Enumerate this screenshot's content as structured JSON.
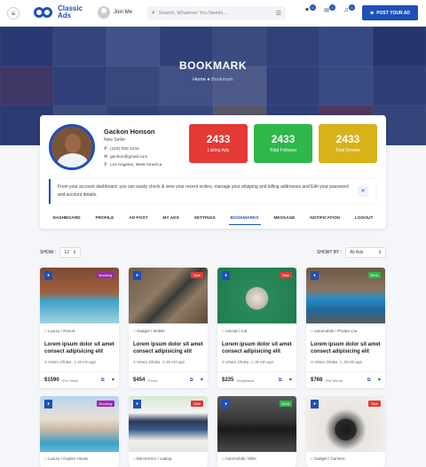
{
  "header": {
    "logo_line1": "Classic",
    "logo_line2": "Ads",
    "join": "Join Me",
    "search_placeholder": "Search, Whatever You Needs...",
    "post_label": "POST YOUR AD",
    "badges": [
      "0",
      "0",
      "0"
    ]
  },
  "hero": {
    "title": "BOOKMARK",
    "home": "Home",
    "current": "Bookmark"
  },
  "profile": {
    "name": "Gackon Honson",
    "role": "New Seller",
    "phone": "(123) 000-1234",
    "email": "gackon@gmail.com",
    "location": "Los Angeles, West America"
  },
  "stats": [
    {
      "value": "2433",
      "label": "Listing Ads",
      "color": "#e53935"
    },
    {
      "value": "2433",
      "label": "Total Follower",
      "color": "#2eb84a"
    },
    {
      "value": "2433",
      "label": "Total Review",
      "color": "#d9b21a"
    }
  ],
  "notice": "From your account dashboard. you can easily check & view your recent orders, manage your shipping and billing addresses and Edit your password and account details.",
  "tabs": [
    "DASHBOARD",
    "PROFILE",
    "AD POST",
    "MY ADS",
    "SETTINGS",
    "BOOKMARKS",
    "MESSAGE",
    "NOTIFICATION",
    "LOGOUT"
  ],
  "controls": {
    "show_label": "SHOW :",
    "show_value": "12",
    "sort_label": "SHORT BY :",
    "sort_value": "All Ads"
  },
  "ads": [
    {
      "cat": "Luxury / Resort",
      "title": "Lorem ipsum dolor sit amet consect adipisicing elit",
      "loc": "Uttara, Dhaka",
      "time": "30 min ago",
      "price": "$1590",
      "unit": "/Per Week",
      "badge": "Booking",
      "badge_color": "#9c27b0"
    },
    {
      "cat": "Gadget / Mobile",
      "title": "Lorem ipsum dolor sit amet consect adipisicing elit",
      "loc": "Uttara, Dhaka",
      "time": "30 min ago",
      "price": "$454",
      "unit": "/Fixed",
      "badge": "Sale",
      "badge_color": "#e53935"
    },
    {
      "cat": "Animal / Cat",
      "title": "Lorem ipsum dolor sit amet consect adipisicing elit",
      "loc": "Uttara, Dhaka",
      "time": "30 min ago",
      "price": "$235",
      "unit": "/Negotiable",
      "badge": "Sale",
      "badge_color": "#e53935"
    },
    {
      "cat": "Automobile / Private Car",
      "title": "Lorem ipsum dolor sit amet consect adipisicing elit",
      "loc": "Uttara, Dhaka",
      "time": "30 min ago",
      "price": "$768",
      "unit": "/Per Month",
      "badge": "Rent",
      "badge_color": "#2eb84a"
    }
  ],
  "ads_row2": [
    {
      "cat": "Luxury / Duplex House",
      "badge": "Booking",
      "badge_color": "#9c27b0"
    },
    {
      "cat": "Electronics / Laptop",
      "badge": "Sale",
      "badge_color": "#e53935"
    },
    {
      "cat": "Automobile / Bike",
      "badge": "Rent",
      "badge_color": "#2eb84a"
    },
    {
      "cat": "Gadget / Camera",
      "badge": "Sale",
      "badge_color": "#e53935"
    }
  ]
}
